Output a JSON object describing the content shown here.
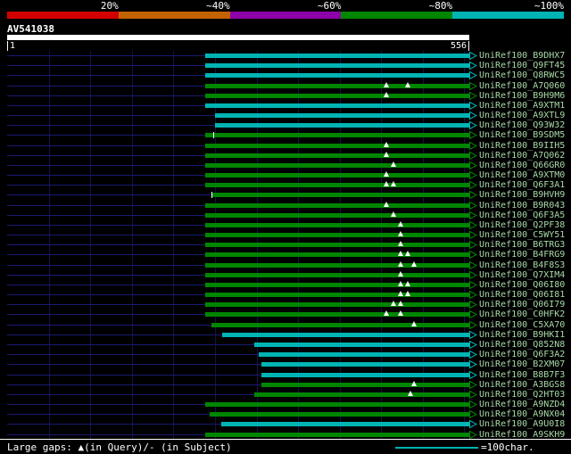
{
  "chart_data": {
    "type": "bar",
    "title": "AV541038",
    "orientation": "horizontal-alignment-ranges",
    "x_range": [
      1,
      556
    ],
    "query": {
      "name": "AV541038",
      "start_label": "1",
      "end_label": "556",
      "length": 556
    },
    "identity_scale": {
      "labels": [
        "20%",
        "~40%",
        "~60%",
        "~80%",
        "~100%"
      ],
      "colors": [
        "#d40000",
        "#c46200",
        "#8e00a8",
        "#008600",
        "#00b4b4"
      ]
    },
    "grid_interval": 50,
    "hits": [
      {
        "label": "UniRef100_B9DHX7",
        "color": "cyan",
        "start": 238,
        "end": 556,
        "gaps": []
      },
      {
        "label": "UniRef100_Q9FT45",
        "color": "cyan",
        "start": 238,
        "end": 556,
        "gaps": []
      },
      {
        "label": "UniRef100_Q8RWC5",
        "color": "cyan",
        "start": 238,
        "end": 556,
        "gaps": []
      },
      {
        "label": "UniRef100_A7Q060",
        "color": "green",
        "start": 238,
        "end": 556,
        "gaps": [
          456,
          482
        ]
      },
      {
        "label": "UniRef100_B9H9M6",
        "color": "green",
        "start": 238,
        "end": 556,
        "gaps": [
          456
        ]
      },
      {
        "label": "UniRef100_A9XTM1",
        "color": "cyan",
        "start": 238,
        "end": 556,
        "gaps": []
      },
      {
        "label": "UniRef100_A9XTL9",
        "color": "cyan",
        "start": 250,
        "end": 556,
        "gaps": []
      },
      {
        "label": "UniRef100_Q93W32",
        "color": "cyan",
        "start": 250,
        "end": 556,
        "gaps": []
      },
      {
        "label": "UniRef100_B9SDM5",
        "color": "green",
        "start": 238,
        "end": 556,
        "gaps": [],
        "ticks": [
          248
        ]
      },
      {
        "label": "UniRef100_B9IIH5",
        "color": "green",
        "start": 238,
        "end": 556,
        "gaps": [
          456
        ]
      },
      {
        "label": "UniRef100_A7Q062",
        "color": "green",
        "start": 238,
        "end": 556,
        "gaps": [
          456
        ]
      },
      {
        "label": "UniRef100_Q66GR0",
        "color": "green",
        "start": 238,
        "end": 556,
        "gaps": [
          465
        ]
      },
      {
        "label": "UniRef100_A9XTM0",
        "color": "green",
        "start": 238,
        "end": 556,
        "gaps": [
          456
        ]
      },
      {
        "label": "UniRef100_Q6F3A1",
        "color": "green",
        "start": 238,
        "end": 556,
        "gaps": [
          456,
          465
        ]
      },
      {
        "label": "UniRef100_B9HVH9",
        "color": "green",
        "start": 246,
        "end": 556,
        "gaps": [],
        "ticks": [
          246
        ]
      },
      {
        "label": "UniRef100_B9R043",
        "color": "green",
        "start": 238,
        "end": 556,
        "gaps": [
          456
        ]
      },
      {
        "label": "UniRef100_Q6F3A5",
        "color": "green",
        "start": 238,
        "end": 556,
        "gaps": [
          465
        ]
      },
      {
        "label": "UniRef100_Q2PF38",
        "color": "green",
        "start": 238,
        "end": 556,
        "gaps": [
          473
        ]
      },
      {
        "label": "UniRef100_C5WY51",
        "color": "green",
        "start": 238,
        "end": 556,
        "gaps": [
          473
        ]
      },
      {
        "label": "UniRef100_B6TRG3",
        "color": "green",
        "start": 238,
        "end": 556,
        "gaps": [
          473
        ]
      },
      {
        "label": "UniRef100_B4FRG9",
        "color": "green",
        "start": 238,
        "end": 556,
        "gaps": [
          473,
          482
        ]
      },
      {
        "label": "UniRef100_B4F8S3",
        "color": "green",
        "start": 238,
        "end": 556,
        "gaps": [
          473,
          490
        ]
      },
      {
        "label": "UniRef100_Q7XIM4",
        "color": "green",
        "start": 238,
        "end": 556,
        "gaps": [
          473
        ]
      },
      {
        "label": "UniRef100_Q06I80",
        "color": "green",
        "start": 238,
        "end": 556,
        "gaps": [
          473,
          482
        ]
      },
      {
        "label": "UniRef100_Q06I81",
        "color": "green",
        "start": 238,
        "end": 556,
        "gaps": [
          473,
          482
        ]
      },
      {
        "label": "UniRef100_Q06I79",
        "color": "green",
        "start": 238,
        "end": 556,
        "gaps": [
          465,
          473
        ]
      },
      {
        "label": "UniRef100_C0HFK2",
        "color": "green",
        "start": 238,
        "end": 556,
        "gaps": [
          456,
          473
        ]
      },
      {
        "label": "UniRef100_C5XA70",
        "color": "green",
        "start": 246,
        "end": 556,
        "gaps": [
          490
        ]
      },
      {
        "label": "UniRef100_B9HKI1",
        "color": "cyan",
        "start": 259,
        "end": 556,
        "gaps": []
      },
      {
        "label": "UniRef100_Q852N8",
        "color": "cyan",
        "start": 297,
        "end": 556,
        "gaps": []
      },
      {
        "label": "UniRef100_Q6F3A2",
        "color": "cyan",
        "start": 303,
        "end": 556,
        "gaps": []
      },
      {
        "label": "UniRef100_B2XM07",
        "color": "cyan",
        "start": 306,
        "end": 556,
        "gaps": []
      },
      {
        "label": "UniRef100_B8B7F3",
        "color": "cyan",
        "start": 306,
        "end": 556,
        "gaps": []
      },
      {
        "label": "UniRef100_A3BGS8",
        "color": "green",
        "start": 306,
        "end": 556,
        "gaps": [
          490
        ]
      },
      {
        "label": "UniRef100_Q2HT03",
        "color": "green",
        "start": 297,
        "end": 556,
        "gaps": [
          485
        ]
      },
      {
        "label": "UniRef100_A9NZD4",
        "color": "green",
        "start": 238,
        "end": 556,
        "gaps": []
      },
      {
        "label": "UniRef100_A9NX04",
        "color": "green",
        "start": 244,
        "end": 556,
        "gaps": []
      },
      {
        "label": "UniRef100_A9U0I8",
        "color": "cyan",
        "start": 258,
        "end": 556,
        "gaps": []
      },
      {
        "label": "UniRef100_A9SKH9",
        "color": "green",
        "start": 238,
        "end": 556,
        "gaps": []
      }
    ]
  },
  "status": {
    "gaps_text": "Large gaps: ▲(in Query)/- (in Subject)",
    "legend_text": "=100char.",
    "legend_chars": 100
  },
  "colors": {
    "green": "#008600",
    "cyan": "#00b4b4"
  }
}
